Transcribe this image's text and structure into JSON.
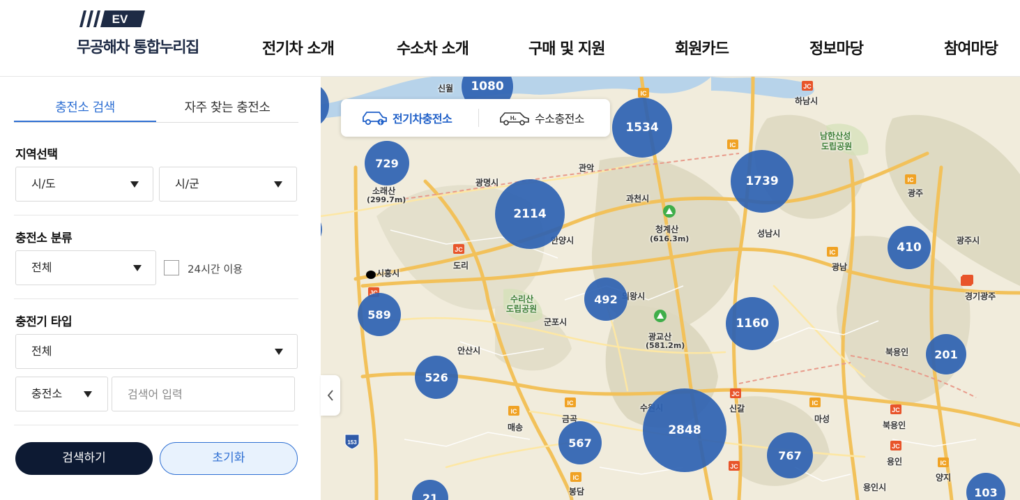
{
  "header": {
    "logo_badge": "EV",
    "logo_text": "무공해차 통합누리집",
    "nav": [
      "전기차 소개",
      "수소차 소개",
      "구매 및 지원",
      "회원카드",
      "정보마당",
      "참여마당"
    ]
  },
  "sidebar": {
    "tabs": [
      "충전소 검색",
      "자주 찾는 충전소"
    ],
    "region": {
      "title": "지역선택",
      "sido": "시/도",
      "sigun": "시/군"
    },
    "category": {
      "title": "충전소 분류",
      "value": "전체",
      "checkbox_label": "24시간 이용"
    },
    "charger_type": {
      "title": "충전기 타입",
      "value": "전체"
    },
    "keyword": {
      "scope": "충전소",
      "placeholder": "검색어 입력"
    },
    "search_button": "검색하기",
    "reset_button": "초기화"
  },
  "map": {
    "toggle": {
      "ev_label": "전기차충전소",
      "h2_label": "수소충전소",
      "active": "ev"
    },
    "clusters": [
      {
        "count": "1080"
      },
      {
        "count": "1534"
      },
      {
        "count": "729"
      },
      {
        "count": "1739"
      },
      {
        "count": "2114"
      },
      {
        "count": "410"
      },
      {
        "count": "492"
      },
      {
        "count": "589"
      },
      {
        "count": "1160"
      },
      {
        "count": "201"
      },
      {
        "count": "526"
      },
      {
        "count": "2848"
      },
      {
        "count": "567"
      },
      {
        "count": "767"
      },
      {
        "count": "103"
      },
      {
        "count": "21"
      }
    ],
    "place_labels": [
      "신월",
      "관악",
      "광명시",
      "과천시",
      "소래산",
      "(299.7m)",
      "시흥시",
      "도리",
      "안양시",
      "청계산",
      "(616.3m)",
      "성남시",
      "하남시",
      "남한산성",
      "도립공원",
      "광주",
      "광주시",
      "광남",
      "수리산",
      "도립공원",
      "군포시",
      "의왕시",
      "광교산",
      "(581.2m)",
      "경기광주",
      "안산시",
      "수원시",
      "금곡",
      "매송",
      "신갈",
      "마성",
      "북용인",
      "북용인",
      "용인",
      "양지",
      "봉담",
      "용인시",
      "153"
    ],
    "jc_labels": [
      "JC",
      "IC"
    ]
  }
}
